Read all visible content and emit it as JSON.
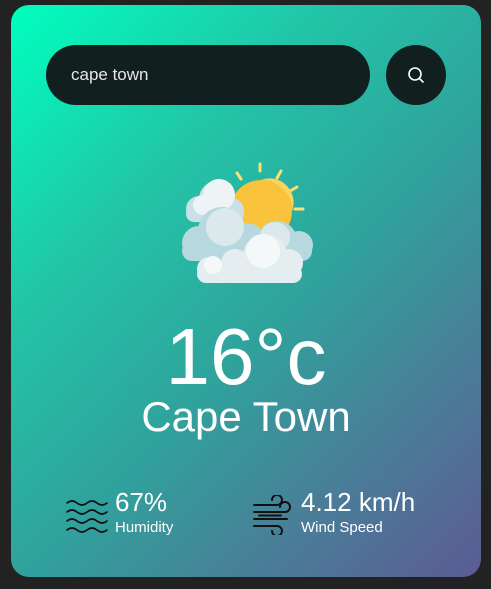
{
  "search": {
    "value": "cape town",
    "button_icon": "search-icon"
  },
  "weather": {
    "icon": "partly-cloudy-icon",
    "temperature": "16°c",
    "city": "Cape Town"
  },
  "details": {
    "humidity": {
      "icon": "humidity-waves-icon",
      "value": "67%",
      "label": "Humidity"
    },
    "wind": {
      "icon": "wind-icon",
      "value": "4.12 km/h",
      "label": "Wind Speed"
    }
  },
  "colors": {
    "gradient_start": "#00ffbf",
    "gradient_end": "#5b5b93",
    "search_background": "#111f1e",
    "page_background": "#222222"
  }
}
